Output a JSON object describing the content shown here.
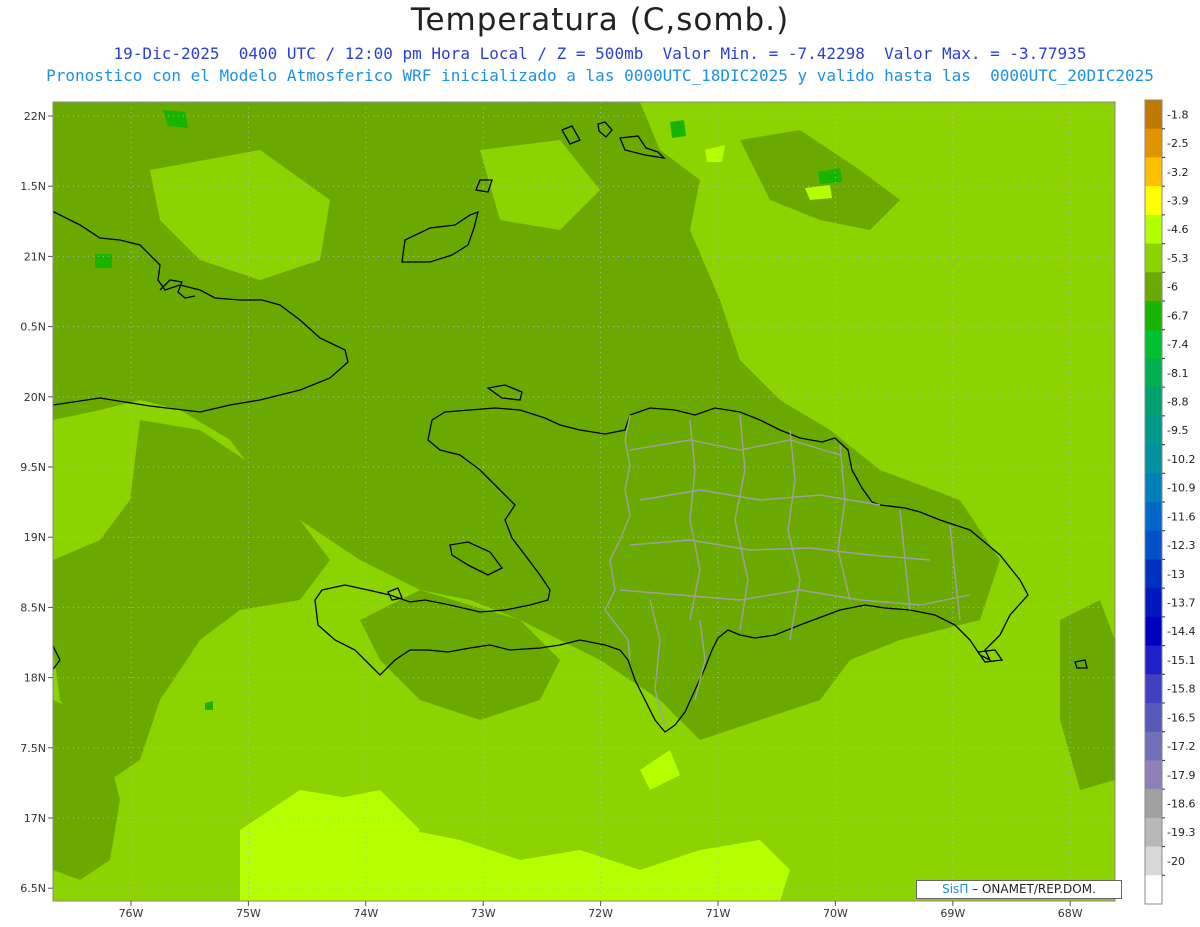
{
  "title": "Temperatura (C,somb.)",
  "subtitle_line1": "19-Dic-2025  0400 UTC / 12:00 pm Hora Local / Z = 500mb  Valor Min. = -7.42298  Valor Max. = -3.77935",
  "subtitle_line2": "Pronostico con el Modelo Atmosferico WRF inicializado a las 0000UTC_18DIC2025 y valido hasta las  0000UTC_20DIC2025",
  "credit": {
    "brand": "SisΠ",
    "text": "– ONAMET/REP.DOM."
  },
  "axes": {
    "lat_labels": [
      "22N",
      "1.5N",
      "21N",
      "0.5N",
      "20N",
      "9.5N",
      "19N",
      "8.5N",
      "18N",
      "7.5N",
      "17N",
      "6.5N"
    ],
    "lon_labels": [
      "76W",
      "75W",
      "74W",
      "73W",
      "72W",
      "71W",
      "70W",
      "69W",
      "68W"
    ]
  },
  "colorbar": {
    "labels": [
      "-1.8",
      "-2.5",
      "-3.2",
      "-3.9",
      "-4.6",
      "-5.3",
      "-6",
      "-6.7",
      "-7.4",
      "-8.1",
      "-8.8",
      "-9.5",
      "-10.2",
      "-10.9",
      "-11.6",
      "-12.3",
      "-13",
      "-13.7",
      "-14.4",
      "-15.1",
      "-15.8",
      "-16.5",
      "-17.2",
      "-17.9",
      "-18.6",
      "-19.3",
      "-20"
    ],
    "colors": [
      "#c07800",
      "#e29400",
      "#ffc000",
      "#ffff00",
      "#b4ff00",
      "#8cd400",
      "#6aaa00",
      "#18b400",
      "#00c030",
      "#00b050",
      "#00a070",
      "#00988a",
      "#0090a0",
      "#0080b8",
      "#0068c8",
      "#0050c8",
      "#0030c0",
      "#0018c0",
      "#0000c0",
      "#2020c8",
      "#4040c0",
      "#5858b8",
      "#7070b8",
      "#9080b8",
      "#a0a0a0",
      "#b8b8b8",
      "#d8d8d8",
      "#ffffff"
    ]
  },
  "colors": {
    "field_base": "#8cd400",
    "field_dark": "#6aaa00",
    "field_light": "#b4ff00",
    "field_green": "#18b400",
    "coast": "#000000",
    "provinces": "#a0a0a0"
  }
}
